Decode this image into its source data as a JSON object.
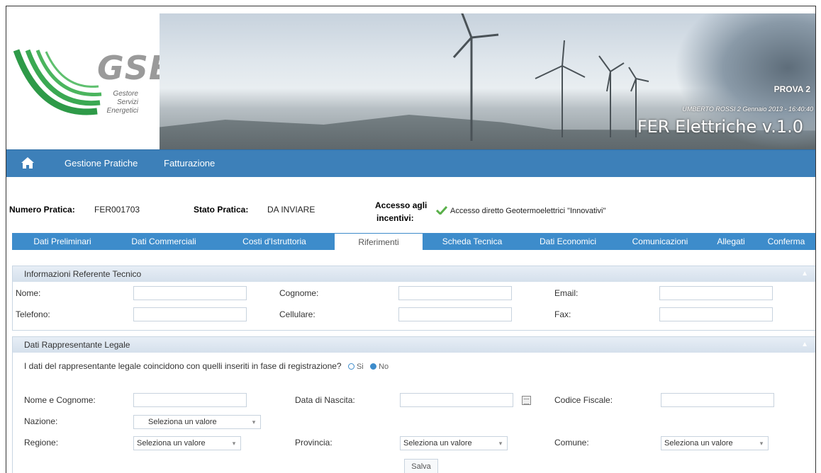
{
  "brand": {
    "logo_text": "GSE",
    "logo_sub": [
      "Gestore",
      "Servizi",
      "Energetici"
    ],
    "env_label": "PROVA 2",
    "user_line": "UMBERTO ROSSI 2 Gennaio 2013 - 16:40:40",
    "app_title": "FER Elettriche  v.1.0"
  },
  "nav": {
    "items": [
      {
        "label": "Gestione Pratiche"
      },
      {
        "label": "Fatturazione"
      }
    ]
  },
  "meta": {
    "numero_label": "Numero Pratica:",
    "numero_value": "FER001703",
    "stato_label": "Stato Pratica:",
    "stato_value": "DA INVIARE",
    "accesso_label_1": "Accesso agli",
    "accesso_label_2": "incentivi:",
    "accesso_value": "Accesso diretto Geotermoelettrici \"Innovativi\""
  },
  "tabs": [
    {
      "label": "Dati Preliminari"
    },
    {
      "label": "Dati Commerciali"
    },
    {
      "label": "Costi d'Istruttoria"
    },
    {
      "label": "Riferimenti"
    },
    {
      "label": "Scheda Tecnica"
    },
    {
      "label": "Dati Economici"
    },
    {
      "label": "Comunicazioni"
    },
    {
      "label": "Allegati"
    },
    {
      "label": "Conferma"
    }
  ],
  "referente": {
    "title": "Informazioni Referente Tecnico",
    "nome": "Nome:",
    "cognome": "Cognome:",
    "email": "Email:",
    "telefono": "Telefono:",
    "cellulare": "Cellulare:",
    "fax": "Fax:"
  },
  "legale": {
    "title": "Dati Rappresentante Legale",
    "question": "I dati del rappresentante legale coincidono con quelli inseriti in fase di registrazione?",
    "opt_si": "Si",
    "opt_no": "No",
    "nome_cognome": "Nome e Cognome:",
    "data_nascita": "Data di Nascita:",
    "codice_fiscale": "Codice Fiscale:",
    "nazione": "Nazione:",
    "regione": "Regione:",
    "provincia": "Provincia:",
    "comune": "Comune:",
    "select_placeholder": "Seleziona un valore"
  },
  "actions": {
    "save": "Salva"
  }
}
